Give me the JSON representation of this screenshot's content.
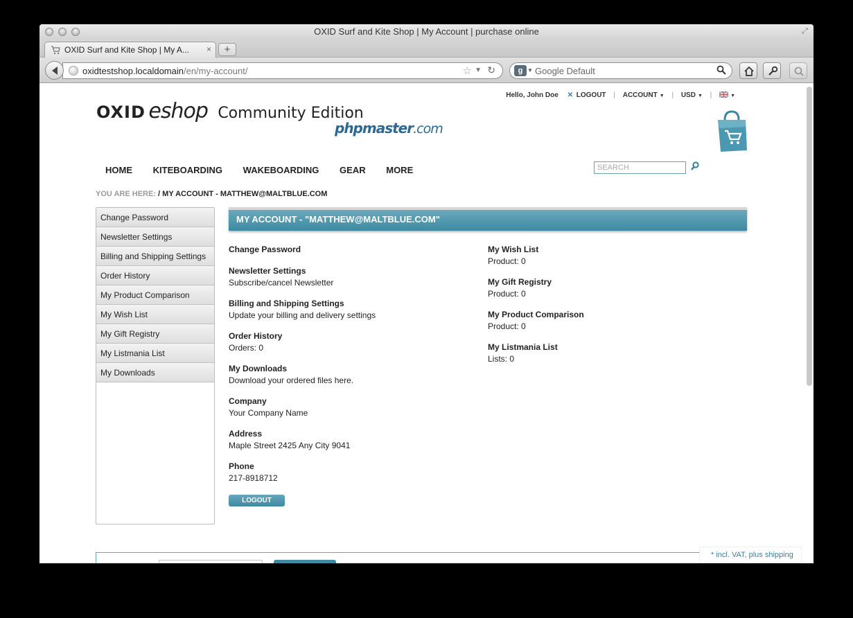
{
  "window": {
    "title": "OXID Surf and Kite Shop | My Account | purchase online"
  },
  "tab": {
    "label": "OXID Surf and Kite Shop | My A...",
    "new_tab": "+"
  },
  "urlbar": {
    "host": "oxidtestshop.localdomain",
    "path": "/en/my-account/"
  },
  "searchbar": {
    "placeholder": "Google Default"
  },
  "header": {
    "logo_oxid": "OXID",
    "logo_eshop": "eshop",
    "logo_edition": "Community Edition",
    "phpmaster_name": "phpmaster",
    "phpmaster_domain": ".com",
    "greeting": "Hello, John Doe",
    "logout": "LOGOUT",
    "account": "ACCOUNT",
    "currency": "USD",
    "search_placeholder": "SEARCH"
  },
  "main_nav": [
    {
      "label": "HOME"
    },
    {
      "label": "KITEBOARDING"
    },
    {
      "label": "WAKEBOARDING"
    },
    {
      "label": "GEAR"
    },
    {
      "label": "MORE"
    }
  ],
  "breadcrumb": {
    "label": "YOU ARE HERE:",
    "path": " / MY ACCOUNT - MATTHEW@MALTBLUE.COM"
  },
  "sidebar": {
    "items": [
      {
        "label": "Change Password"
      },
      {
        "label": "Newsletter Settings"
      },
      {
        "label": "Billing and Shipping Settings"
      },
      {
        "label": "Order History"
      },
      {
        "label": "My Product Comparison"
      },
      {
        "label": "My Wish List"
      },
      {
        "label": "My Gift Registry"
      },
      {
        "label": "My Listmania List"
      },
      {
        "label": "My Downloads"
      }
    ]
  },
  "content": {
    "heading": "MY ACCOUNT - \"MATTHEW@MALTBLUE.COM\"",
    "left": [
      {
        "title": "Change Password",
        "value": ""
      },
      {
        "title": "Newsletter Settings",
        "value": "Subscribe/cancel Newsletter"
      },
      {
        "title": "Billing and Shipping Settings",
        "value": "Update your billing and delivery settings"
      },
      {
        "title": "Order History",
        "value": "Orders: 0"
      },
      {
        "title": "My Downloads",
        "value": "Download your ordered files here."
      },
      {
        "title": "Company",
        "value": "Your Company Name"
      },
      {
        "title": "Address",
        "value": "Maple Street 2425 Any City 9041"
      },
      {
        "title": "Phone",
        "value": "217-8918712"
      }
    ],
    "right": [
      {
        "title": "My Wish List",
        "value": "Product: 0"
      },
      {
        "title": "My Gift Registry",
        "value": "Product: 0"
      },
      {
        "title": "My Product Comparison",
        "value": "Product: 0"
      },
      {
        "title": "My Listmania List",
        "value": "Lists: 0"
      }
    ],
    "logout_button": "LOGOUT"
  },
  "footer": {
    "vat_note": "* incl. VAT, plus shipping"
  },
  "colors": {
    "accent": "#3e8aa3",
    "link": "#2b6a96"
  }
}
